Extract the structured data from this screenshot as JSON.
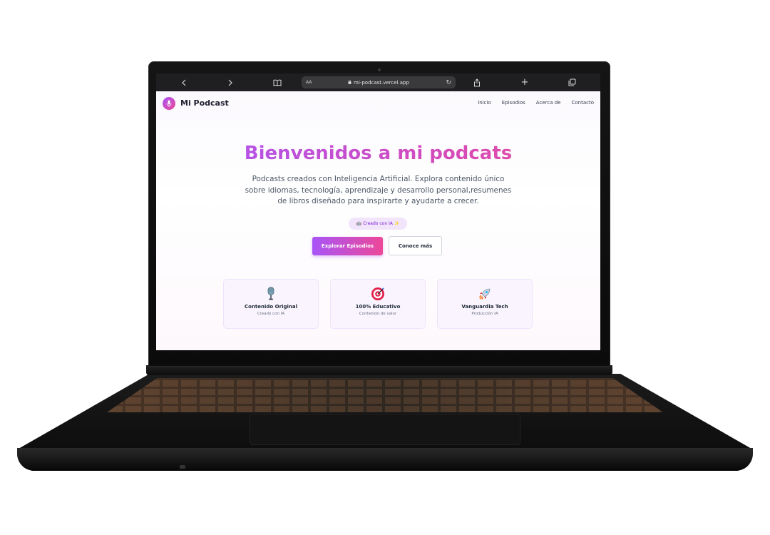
{
  "browser": {
    "back_icon": "‹",
    "forward_icon": "›",
    "aa_label": "AA",
    "url": "mi-podcast.vercel.app",
    "reload_icon": "↻",
    "share_icon": "share",
    "new_tab_icon": "+",
    "tabs_icon": "tabs"
  },
  "nav": {
    "logo_text": "Mi Podcast",
    "links": [
      "Inicio",
      "Episodios",
      "Acerca de",
      "Contacto"
    ]
  },
  "hero": {
    "title": "Bienvenidos a mi podcats",
    "subtitle_lines": [
      "Podcasts creados con Inteligencia Artificial. Explora contenido único",
      "sobre idiomas, tecnología, aprendizaje y desarrollo personal,resumenes",
      "de libros diseñado para inspirarte y ayudarte a crecer."
    ],
    "badge": "🤖 Creado con IA ✨",
    "primary_button": "Explorar Episodios",
    "secondary_button": "Conoce más"
  },
  "features": [
    {
      "icon": "microphone-icon",
      "title": "Contenido Original",
      "subtitle": "Creado con IA"
    },
    {
      "icon": "target-icon",
      "title": "100% Educativo",
      "subtitle": "Contenido de valor"
    },
    {
      "icon": "rocket-icon",
      "title": "Vanguardia Tech",
      "subtitle": "Producción IA"
    }
  ],
  "colors": {
    "accent_start": "#a855f7",
    "accent_end": "#ec4899",
    "browser_bar": "#1f1f21"
  }
}
